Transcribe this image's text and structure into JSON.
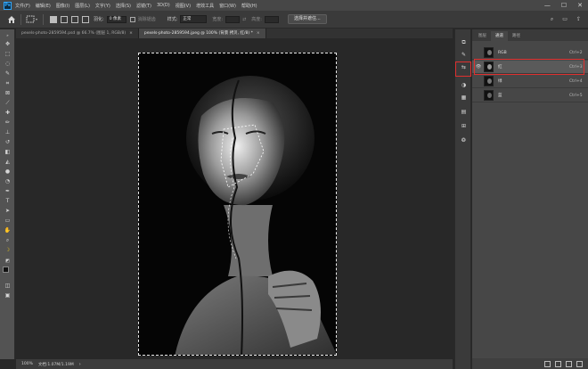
{
  "menubar": {
    "logo": "Ps",
    "items": [
      "文件(F)",
      "编辑(E)",
      "图像(I)",
      "图层(L)",
      "文字(Y)",
      "选择(S)",
      "滤镜(T)",
      "3D(D)",
      "视图(V)",
      "增效工具",
      "窗口(W)",
      "帮助(H)"
    ],
    "controls": {
      "minimize": "—",
      "maximize": "☐",
      "close": "✕"
    }
  },
  "options": {
    "feather_label": "羽化:",
    "feather_value": "0 像素",
    "antialias_label": "消除锯齿",
    "style_label": "样式:",
    "style_value": "正常",
    "width_label": "宽度:",
    "height_label": "高度:",
    "select_subject_button": "选择并遮住..."
  },
  "tabs": [
    {
      "label": "pexels-photo-2859594.psd @ 66.7% (图层 1, RGB/8)",
      "close": "×"
    },
    {
      "label": "pexels-photo-2859594.jpeg @ 100% (背景 拷贝, 红/8) *",
      "close": "×"
    }
  ],
  "status": {
    "zoom": "100%",
    "doc": "文档:1.07M/1.19M",
    "arrow": "›"
  },
  "panel": {
    "tabs": [
      "图层",
      "通道",
      "路径"
    ],
    "channels": [
      {
        "name": "RGB",
        "shortcut": "Ctrl+2"
      },
      {
        "name": "红",
        "shortcut": "Ctrl+3"
      },
      {
        "name": "绿",
        "shortcut": "Ctrl+4"
      },
      {
        "name": "蓝",
        "shortcut": "Ctrl+5"
      }
    ]
  },
  "icons": {
    "home": "home-icon",
    "move": "move-icon",
    "marquee": "marquee-icon",
    "lasso": "lasso-icon",
    "eye": "eye-icon"
  },
  "colors": {
    "highlight": "#e0302f",
    "photoshop_blue": "#31a8ff"
  }
}
